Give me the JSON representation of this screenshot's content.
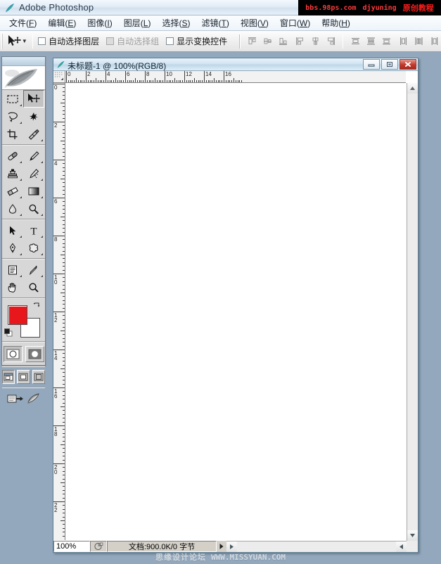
{
  "app": {
    "title": "Adobe Photoshop",
    "icon": "photoshop-feather-icon"
  },
  "watermark_top": {
    "site": "bbs.98ps.com",
    "author": "djyuning",
    "label": "原创教程"
  },
  "watermark_bottom": {
    "forum": "思缘设计论坛",
    "url": "WWW.MISSYUAN.COM"
  },
  "menubar": {
    "items": [
      {
        "label": "文件",
        "accel": "F"
      },
      {
        "label": "编辑",
        "accel": "E"
      },
      {
        "label": "图像",
        "accel": "I"
      },
      {
        "label": "图层",
        "accel": "L"
      },
      {
        "label": "选择",
        "accel": "S"
      },
      {
        "label": "滤镜",
        "accel": "T"
      },
      {
        "label": "视图",
        "accel": "V"
      },
      {
        "label": "窗口",
        "accel": "W"
      },
      {
        "label": "帮助",
        "accel": "H"
      }
    ]
  },
  "options_bar": {
    "active_tool": "move-tool",
    "checkboxes": [
      {
        "label": "自动选择图层",
        "checked": false,
        "enabled": true
      },
      {
        "label": "自动选择组",
        "checked": true,
        "enabled": false
      },
      {
        "label": "显示变换控件",
        "checked": false,
        "enabled": true
      }
    ],
    "align_group_1": [
      "align-top-edges",
      "align-vertical-centers",
      "align-bottom-edges"
    ],
    "align_group_2": [
      "align-left-edges",
      "align-horizontal-centers",
      "align-right-edges"
    ],
    "distribute_group_1": [
      "distribute-top-edges",
      "distribute-vertical-centers",
      "distribute-bottom-edges"
    ],
    "distribute_group_2": [
      "distribute-left-edges",
      "distribute-horizontal-centers",
      "distribute-right-edges"
    ]
  },
  "toolbox": {
    "tools": [
      {
        "name": "rectangular-marquee-tool",
        "selected": false,
        "more": true
      },
      {
        "name": "move-tool",
        "selected": true,
        "more": false
      },
      {
        "name": "lasso-tool",
        "selected": false,
        "more": true
      },
      {
        "name": "magic-wand-tool",
        "selected": false,
        "more": false
      },
      {
        "name": "crop-tool",
        "selected": false,
        "more": false
      },
      {
        "name": "slice-tool",
        "selected": false,
        "more": true
      },
      {
        "name": "healing-brush-tool",
        "selected": false,
        "more": true
      },
      {
        "name": "brush-tool",
        "selected": false,
        "more": true
      },
      {
        "name": "clone-stamp-tool",
        "selected": false,
        "more": true
      },
      {
        "name": "history-brush-tool",
        "selected": false,
        "more": true
      },
      {
        "name": "eraser-tool",
        "selected": false,
        "more": true
      },
      {
        "name": "gradient-tool",
        "selected": false,
        "more": true
      },
      {
        "name": "blur-tool",
        "selected": false,
        "more": true
      },
      {
        "name": "dodge-tool",
        "selected": false,
        "more": true
      },
      {
        "name": "path-selection-tool",
        "selected": false,
        "more": true
      },
      {
        "name": "type-tool",
        "selected": false,
        "more": true
      },
      {
        "name": "pen-tool",
        "selected": false,
        "more": true
      },
      {
        "name": "custom-shape-tool",
        "selected": false,
        "more": true
      },
      {
        "name": "notes-tool",
        "selected": false,
        "more": true
      },
      {
        "name": "eyedropper-tool",
        "selected": false,
        "more": true
      },
      {
        "name": "hand-tool",
        "selected": false,
        "more": false
      },
      {
        "name": "zoom-tool",
        "selected": false,
        "more": false
      }
    ],
    "colors": {
      "foreground": "#E8171B",
      "background": "#FFFFFF",
      "swap_icon": "swap-colors-icon",
      "default_icon": "default-colors-icon"
    },
    "mask_modes": [
      {
        "name": "standard-mode-button",
        "selected": true
      },
      {
        "name": "quick-mask-mode-button",
        "selected": false
      }
    ],
    "screen_modes": [
      {
        "name": "standard-screen-mode-button",
        "selected": true
      },
      {
        "name": "full-screen-with-menubar-button",
        "selected": false
      },
      {
        "name": "full-screen-mode-button",
        "selected": false
      }
    ],
    "jump_to": [
      {
        "name": "jump-to-imageready-button"
      },
      {
        "name": "edit-in-imageready-button"
      }
    ]
  },
  "document": {
    "title": "未标题-1 @ 100%(RGB/8)",
    "window_buttons": [
      {
        "name": "minimize-button",
        "glyph": "minimize"
      },
      {
        "name": "maximize-button",
        "glyph": "maximize"
      },
      {
        "name": "close-button",
        "glyph": "close"
      }
    ],
    "ruler": {
      "unit": "cm",
      "horizontal_labels": [
        "0",
        "2",
        "4",
        "6",
        "8",
        "10",
        "12",
        "14",
        "16"
      ],
      "vertical_labels": [
        "0",
        "2",
        "4",
        "6",
        "8",
        "10",
        "12",
        "14",
        "16",
        "18",
        "20",
        "22"
      ]
    },
    "canvas": {
      "background": "#FFFFFF",
      "zoom": "100%"
    },
    "statusbar": {
      "zoom": "100%",
      "preview_icon": "document-preview-icon",
      "doc_info": "文档:900.0K/0 字节",
      "menu_arrow": "status-menu-arrow"
    }
  }
}
